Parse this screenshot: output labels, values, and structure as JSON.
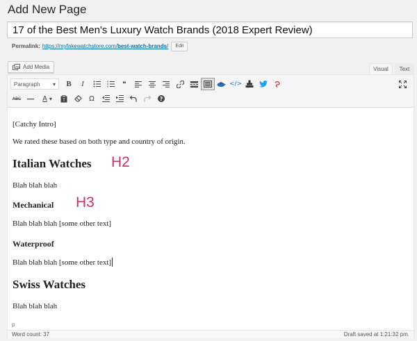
{
  "page": {
    "heading": "Add New Page"
  },
  "title": {
    "value": "17 of the Best Men's Luxury Watch Brands (2018 Expert Review)"
  },
  "permalink": {
    "label": "Permalink:",
    "url_base": "https://myfakewatchstore.com/",
    "url_slug": "best-watch-brands",
    "url_end": "/",
    "edit_label": "Edit"
  },
  "media": {
    "add_label": "Add Media"
  },
  "tabs": {
    "visual": "Visual",
    "text": "Text"
  },
  "toolbar": {
    "format_value": "Paragraph",
    "bold": "B",
    "italic": "I",
    "strike_label": "ABC",
    "text_color_label": "A",
    "omega": "Ω",
    "help": "?"
  },
  "content": {
    "p1": "[Catchy Intro]",
    "p2": "We rated these based on both type and country of origin.",
    "h2_1": "Italian Watches",
    "p3": "Blah blah blah",
    "h3_1": "Mechanical",
    "p4": "Blah blah blah [some other text]",
    "h3_2": "Waterproof",
    "p5": "Blah blah blah [some other text]",
    "h2_2": "Swiss Watches",
    "p6": "Blah blah blah"
  },
  "annotations": {
    "h2_note": "H2",
    "h3_note": "H3"
  },
  "path": {
    "value": "p"
  },
  "status": {
    "word_count": "Word count: 37",
    "draft_saved": "Draft saved at 1:21:32 pm."
  },
  "colors": {
    "link": "#0073aa",
    "annotation": "#c92f6a",
    "twitter": "#1da1f2",
    "accent_blue": "#2271b1"
  }
}
